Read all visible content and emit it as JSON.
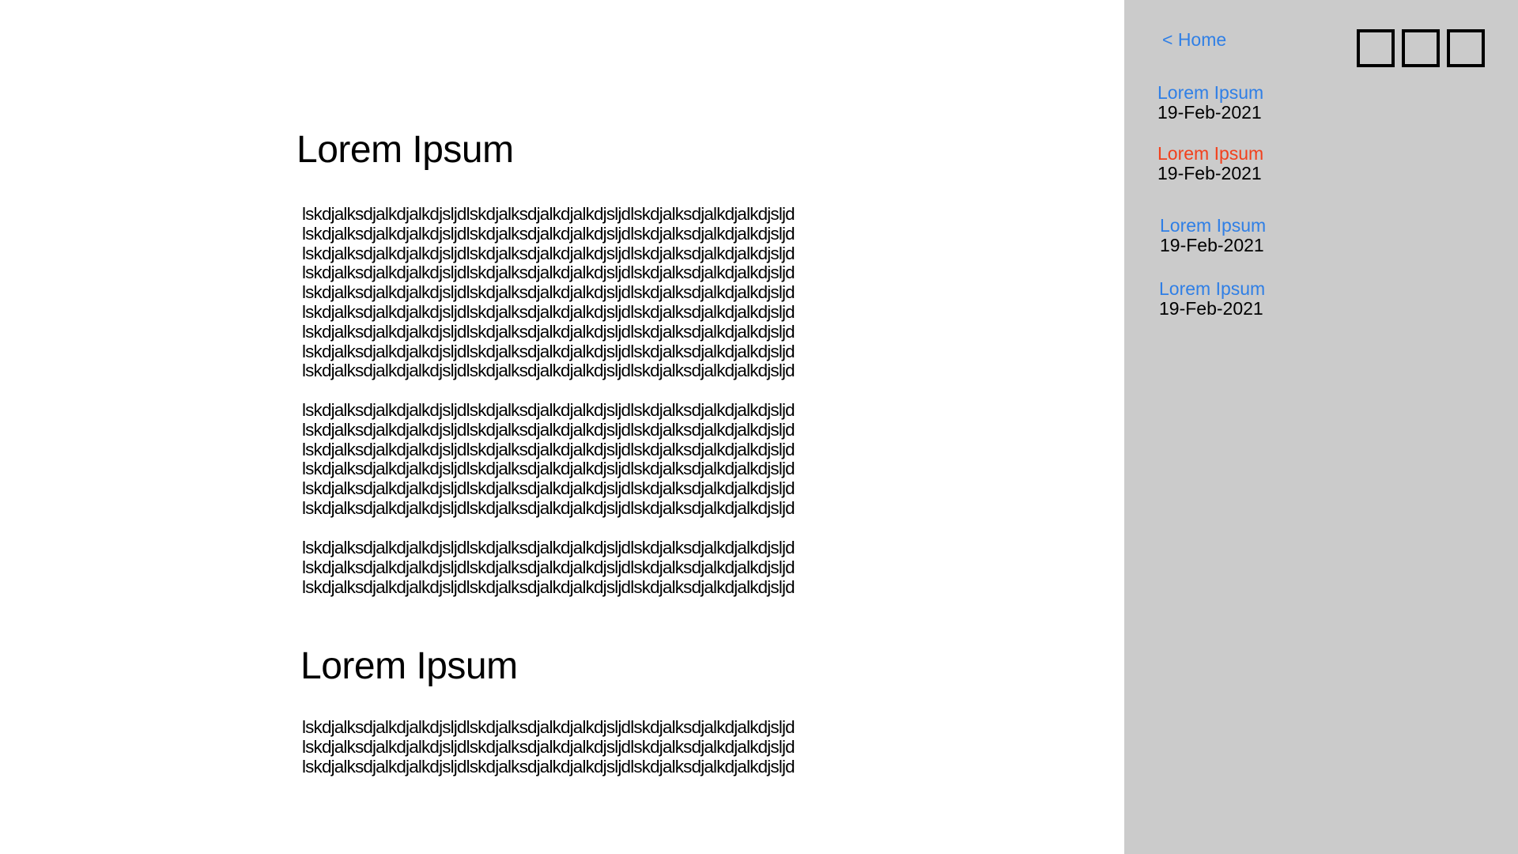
{
  "article": {
    "sections": [
      {
        "heading": "Lorem Ipsum",
        "paragraphs": [
          [
            "lskdjalksdjalkdjalkdjsljdlskdjalksdjalkdjalkdjsljdlskdjalksdjalkdjalkdjsljd",
            "lskdjalksdjalkdjalkdjsljdlskdjalksdjalkdjalkdjsljdlskdjalksdjalkdjalkdjsljd",
            "lskdjalksdjalkdjalkdjsljdlskdjalksdjalkdjalkdjsljdlskdjalksdjalkdjalkdjsljd",
            "lskdjalksdjalkdjalkdjsljdlskdjalksdjalkdjalkdjsljdlskdjalksdjalkdjalkdjsljd",
            "lskdjalksdjalkdjalkdjsljdlskdjalksdjalkdjalkdjsljdlskdjalksdjalkdjalkdjsljd",
            "lskdjalksdjalkdjalkdjsljdlskdjalksdjalkdjalkdjsljdlskdjalksdjalkdjalkdjsljd",
            "lskdjalksdjalkdjalkdjsljdlskdjalksdjalkdjalkdjsljdlskdjalksdjalkdjalkdjsljd",
            "lskdjalksdjalkdjalkdjsljdlskdjalksdjalkdjalkdjsljdlskdjalksdjalkdjalkdjsljd",
            "lskdjalksdjalkdjalkdjsljdlskdjalksdjalkdjalkdjsljdlskdjalksdjalkdjalkdjsljd"
          ],
          [
            "lskdjalksdjalkdjalkdjsljdlskdjalksdjalkdjalkdjsljdlskdjalksdjalkdjalkdjsljd",
            "lskdjalksdjalkdjalkdjsljdlskdjalksdjalkdjalkdjsljdlskdjalksdjalkdjalkdjsljd",
            "lskdjalksdjalkdjalkdjsljdlskdjalksdjalkdjalkdjsljdlskdjalksdjalkdjalkdjsljd",
            "lskdjalksdjalkdjalkdjsljdlskdjalksdjalkdjalkdjsljdlskdjalksdjalkdjalkdjsljd",
            "lskdjalksdjalkdjalkdjsljdlskdjalksdjalkdjalkdjsljdlskdjalksdjalkdjalkdjsljd",
            "lskdjalksdjalkdjalkdjsljdlskdjalksdjalkdjalkdjsljdlskdjalksdjalkdjalkdjsljd"
          ],
          [
            "lskdjalksdjalkdjalkdjsljdlskdjalksdjalkdjalkdjsljdlskdjalksdjalkdjalkdjsljd",
            "lskdjalksdjalkdjalkdjsljdlskdjalksdjalkdjalkdjsljdlskdjalksdjalkdjalkdjsljd",
            "lskdjalksdjalkdjalkdjsljdlskdjalksdjalkdjalkdjsljdlskdjalksdjalkdjalkdjsljd"
          ]
        ]
      },
      {
        "heading": "Lorem Ipsum",
        "paragraphs": [
          [
            "lskdjalksdjalkdjalkdjsljdlskdjalksdjalkdjalkdjsljdlskdjalksdjalkdjalkdjsljd",
            "lskdjalksdjalkdjalkdjsljdlskdjalksdjalkdjalkdjsljdlskdjalksdjalkdjalkdjsljd",
            "lskdjalksdjalkdjalkdjsljdlskdjalksdjalkdjalkdjsljdlskdjalksdjalkdjalkdjsljd"
          ]
        ]
      }
    ]
  },
  "sidebar": {
    "home_label": "< Home",
    "background": "#cbcbcb",
    "posts": [
      {
        "title": "Lorem Ipsum",
        "date": "19-Feb-2021",
        "color": "#2f7fe6"
      },
      {
        "title": "Lorem Ipsum",
        "date": "19-Feb-2021",
        "color": "#f2401c"
      },
      {
        "title": "Lorem Ipsum",
        "date": "19-Feb-2021",
        "color": "#2f7fe6"
      },
      {
        "title": "Lorem Ipsum",
        "date": "19-Feb-2021",
        "color": "#2f7fe6"
      }
    ],
    "window_controls": [
      "minimize-box",
      "maximize-box",
      "close-box"
    ]
  },
  "colors": {
    "link": "#2f7fe6",
    "active_link": "#f2401c",
    "text": "#000000"
  }
}
